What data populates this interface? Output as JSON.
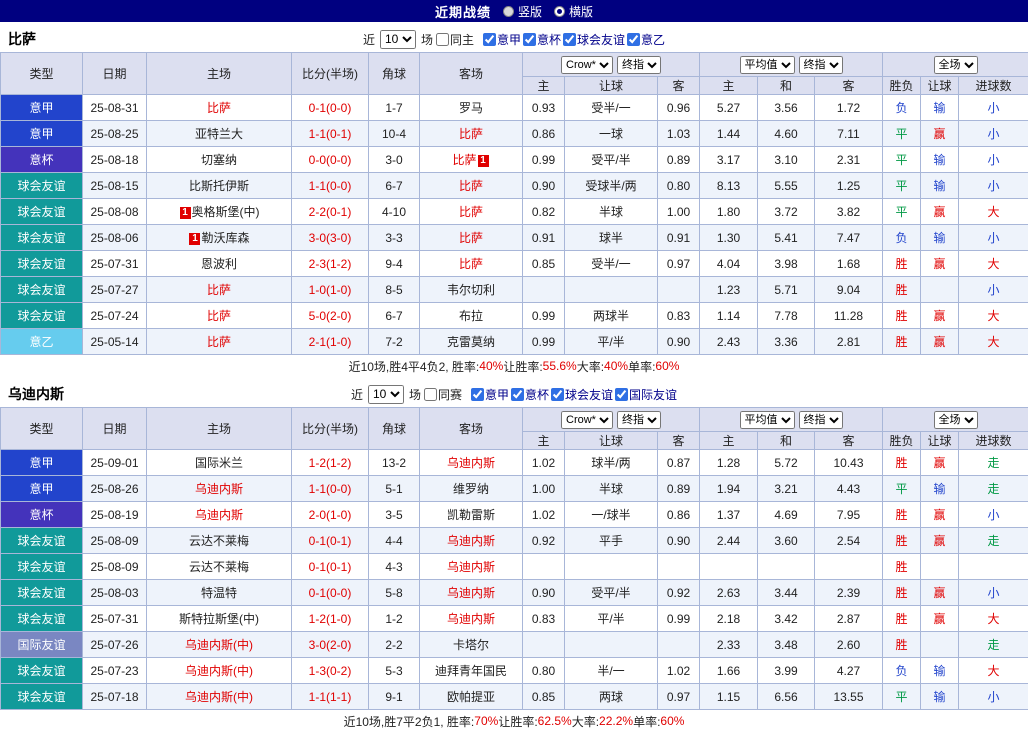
{
  "top_bar": {
    "title": "近期战绩",
    "radios": [
      {
        "label": "竖版",
        "selected": false
      },
      {
        "label": "横版",
        "selected": true
      }
    ]
  },
  "table_header": {
    "type": "类型",
    "date": "日期",
    "home": "主场",
    "score": "比分(半场)",
    "corner": "角球",
    "away": "客场",
    "odds_selects": [
      "Crow*",
      "终指"
    ],
    "avg_selects": [
      "平均值",
      "终指"
    ],
    "full_selects": [
      "全场"
    ],
    "sub_headers": [
      "主",
      "让球",
      "客",
      "主",
      "和",
      "客",
      "胜负",
      "让球",
      "进球数"
    ]
  },
  "type_colors": {
    "意甲": "#2244cc",
    "意杯": "#4433bb",
    "意乙": "#66ccee",
    "球会友谊": "#119a9a",
    "国际友谊": "#7a87c2"
  },
  "value_colors": {
    "胜": "#e00000",
    "平": "#009944",
    "负": "#2244cc",
    "赢": "#e00000",
    "输": "#2244cc",
    "大": "#e00000",
    "小": "#2244cc",
    "走": "#009944"
  },
  "sections": [
    {
      "team": "比萨",
      "filter": {
        "near_label": "近",
        "count": "10",
        "games_label": "场",
        "same_label": "同主",
        "same_checked": false,
        "leagues": [
          {
            "label": "意甲",
            "checked": true
          },
          {
            "label": "意杯",
            "checked": true
          },
          {
            "label": "球会友谊",
            "checked": true
          },
          {
            "label": "意乙",
            "checked": true
          }
        ]
      },
      "rows": [
        {
          "type": "意甲",
          "date": "25-08-31",
          "home": "比萨",
          "home_red": true,
          "home_badge": "",
          "score": "0-1(0-0)",
          "corner": "1-7",
          "away": "罗马",
          "away_red": false,
          "away_badge": "",
          "odds": [
            "0.93",
            "受半/一",
            "0.96"
          ],
          "avg": [
            "5.27",
            "3.56",
            "1.72"
          ],
          "res": [
            "负",
            "输",
            "小"
          ]
        },
        {
          "type": "意甲",
          "date": "25-08-25",
          "home": "亚特兰大",
          "home_red": false,
          "home_badge": "",
          "score": "1-1(0-1)",
          "corner": "10-4",
          "away": "比萨",
          "away_red": true,
          "away_badge": "",
          "odds": [
            "0.86",
            "一球",
            "1.03"
          ],
          "avg": [
            "1.44",
            "4.60",
            "7.11"
          ],
          "res": [
            "平",
            "赢",
            "小"
          ]
        },
        {
          "type": "意杯",
          "date": "25-08-18",
          "home": "切塞纳",
          "home_red": false,
          "home_badge": "",
          "score": "0-0(0-0)",
          "corner": "3-0",
          "away": "比萨",
          "away_red": true,
          "away_badge": "1",
          "odds": [
            "0.99",
            "受平/半",
            "0.89"
          ],
          "avg": [
            "3.17",
            "3.10",
            "2.31"
          ],
          "res": [
            "平",
            "输",
            "小"
          ]
        },
        {
          "type": "球会友谊",
          "date": "25-08-15",
          "home": "比斯托伊斯",
          "home_red": false,
          "home_badge": "",
          "score": "1-1(0-0)",
          "corner": "6-7",
          "away": "比萨",
          "away_red": true,
          "away_badge": "",
          "odds": [
            "0.90",
            "受球半/两",
            "0.80"
          ],
          "avg": [
            "8.13",
            "5.55",
            "1.25"
          ],
          "res": [
            "平",
            "输",
            "小"
          ]
        },
        {
          "type": "球会友谊",
          "date": "25-08-08",
          "home": "奥格斯堡(中)",
          "home_red": false,
          "home_badge": "1",
          "score": "2-2(0-1)",
          "corner": "4-10",
          "away": "比萨",
          "away_red": true,
          "away_badge": "",
          "odds": [
            "0.82",
            "半球",
            "1.00"
          ],
          "avg": [
            "1.80",
            "3.72",
            "3.82"
          ],
          "res": [
            "平",
            "赢",
            "大"
          ]
        },
        {
          "type": "球会友谊",
          "date": "25-08-06",
          "home": "勒沃库森",
          "home_red": false,
          "home_badge": "1",
          "score": "3-0(3-0)",
          "corner": "3-3",
          "away": "比萨",
          "away_red": true,
          "away_badge": "",
          "odds": [
            "0.91",
            "球半",
            "0.91"
          ],
          "avg": [
            "1.30",
            "5.41",
            "7.47"
          ],
          "res": [
            "负",
            "输",
            "小"
          ]
        },
        {
          "type": "球会友谊",
          "date": "25-07-31",
          "home": "恩波利",
          "home_red": false,
          "home_badge": "",
          "score": "2-3(1-2)",
          "corner": "9-4",
          "away": "比萨",
          "away_red": true,
          "away_badge": "",
          "odds": [
            "0.85",
            "受半/一",
            "0.97"
          ],
          "avg": [
            "4.04",
            "3.98",
            "1.68"
          ],
          "res": [
            "胜",
            "赢",
            "大"
          ]
        },
        {
          "type": "球会友谊",
          "date": "25-07-27",
          "home": "比萨",
          "home_red": true,
          "home_badge": "",
          "score": "1-0(1-0)",
          "corner": "8-5",
          "away": "韦尔切利",
          "away_red": false,
          "away_badge": "",
          "odds": [
            "",
            "",
            ""
          ],
          "avg": [
            "1.23",
            "5.71",
            "9.04"
          ],
          "res": [
            "胜",
            "",
            "小"
          ]
        },
        {
          "type": "球会友谊",
          "date": "25-07-24",
          "home": "比萨",
          "home_red": true,
          "home_badge": "",
          "score": "5-0(2-0)",
          "corner": "6-7",
          "away": "布拉",
          "away_red": false,
          "away_badge": "",
          "odds": [
            "0.99",
            "两球半",
            "0.83"
          ],
          "avg": [
            "1.14",
            "7.78",
            "11.28"
          ],
          "res": [
            "胜",
            "赢",
            "大"
          ]
        },
        {
          "type": "意乙",
          "date": "25-05-14",
          "home": "比萨",
          "home_red": true,
          "home_badge": "",
          "score": "2-1(1-0)",
          "corner": "7-2",
          "away": "克雷莫纳",
          "away_red": false,
          "away_badge": "",
          "odds": [
            "0.99",
            "平/半",
            "0.90"
          ],
          "avg": [
            "2.43",
            "3.36",
            "2.81"
          ],
          "res": [
            "胜",
            "赢",
            "大"
          ]
        }
      ],
      "summary_parts": [
        {
          "text": "近10场,胜4平4负2, 胜率:",
          "red": false
        },
        {
          "text": "40%",
          "red": true
        },
        {
          "text": " 让胜率:",
          "red": false
        },
        {
          "text": "55.6%",
          "red": true
        },
        {
          "text": " 大率:",
          "red": false
        },
        {
          "text": "40%",
          "red": true
        },
        {
          "text": " 单率:",
          "red": false
        },
        {
          "text": "60%",
          "red": true
        }
      ]
    },
    {
      "team": "乌迪内斯",
      "filter": {
        "near_label": "近",
        "count": "10",
        "games_label": "场",
        "same_label": "同赛",
        "same_checked": false,
        "leagues": [
          {
            "label": "意甲",
            "checked": true
          },
          {
            "label": "意杯",
            "checked": true
          },
          {
            "label": "球会友谊",
            "checked": true
          },
          {
            "label": "国际友谊",
            "checked": true
          }
        ]
      },
      "rows": [
        {
          "type": "意甲",
          "date": "25-09-01",
          "home": "国际米兰",
          "home_red": false,
          "home_badge": "",
          "score": "1-2(1-2)",
          "corner": "13-2",
          "away": "乌迪内斯",
          "away_red": true,
          "away_badge": "",
          "odds": [
            "1.02",
            "球半/两",
            "0.87"
          ],
          "avg": [
            "1.28",
            "5.72",
            "10.43"
          ],
          "res": [
            "胜",
            "赢",
            "走"
          ]
        },
        {
          "type": "意甲",
          "date": "25-08-26",
          "home": "乌迪内斯",
          "home_red": true,
          "home_badge": "",
          "score": "1-1(0-0)",
          "corner": "5-1",
          "away": "维罗纳",
          "away_red": false,
          "away_badge": "",
          "odds": [
            "1.00",
            "半球",
            "0.89"
          ],
          "avg": [
            "1.94",
            "3.21",
            "4.43"
          ],
          "res": [
            "平",
            "输",
            "走"
          ]
        },
        {
          "type": "意杯",
          "date": "25-08-19",
          "home": "乌迪内斯",
          "home_red": true,
          "home_badge": "",
          "score": "2-0(1-0)",
          "corner": "3-5",
          "away": "凯勒雷斯",
          "away_red": false,
          "away_badge": "",
          "odds": [
            "1.02",
            "一/球半",
            "0.86"
          ],
          "avg": [
            "1.37",
            "4.69",
            "7.95"
          ],
          "res": [
            "胜",
            "赢",
            "小"
          ]
        },
        {
          "type": "球会友谊",
          "date": "25-08-09",
          "home": "云达不莱梅",
          "home_red": false,
          "home_badge": "",
          "score": "0-1(0-1)",
          "corner": "4-4",
          "away": "乌迪内斯",
          "away_red": true,
          "away_badge": "",
          "odds": [
            "0.92",
            "平手",
            "0.90"
          ],
          "avg": [
            "2.44",
            "3.60",
            "2.54"
          ],
          "res": [
            "胜",
            "赢",
            "走"
          ]
        },
        {
          "type": "球会友谊",
          "date": "25-08-09",
          "home": "云达不莱梅",
          "home_red": false,
          "home_badge": "",
          "score": "0-1(0-1)",
          "corner": "4-3",
          "away": "乌迪内斯",
          "away_red": true,
          "away_badge": "",
          "odds": [
            "",
            "",
            ""
          ],
          "avg": [
            "",
            "",
            ""
          ],
          "res": [
            "胜",
            "",
            ""
          ]
        },
        {
          "type": "球会友谊",
          "date": "25-08-03",
          "home": "特温特",
          "home_red": false,
          "home_badge": "",
          "score": "0-1(0-0)",
          "corner": "5-8",
          "away": "乌迪内斯",
          "away_red": true,
          "away_badge": "",
          "odds": [
            "0.90",
            "受平/半",
            "0.92"
          ],
          "avg": [
            "2.63",
            "3.44",
            "2.39"
          ],
          "res": [
            "胜",
            "赢",
            "小"
          ]
        },
        {
          "type": "球会友谊",
          "date": "25-07-31",
          "home": "斯特拉斯堡(中)",
          "home_red": false,
          "home_badge": "",
          "score": "1-2(1-0)",
          "corner": "1-2",
          "away": "乌迪内斯",
          "away_red": true,
          "away_badge": "",
          "odds": [
            "0.83",
            "平/半",
            "0.99"
          ],
          "avg": [
            "2.18",
            "3.42",
            "2.87"
          ],
          "res": [
            "胜",
            "赢",
            "大"
          ]
        },
        {
          "type": "国际友谊",
          "date": "25-07-26",
          "home": "乌迪内斯(中)",
          "home_red": true,
          "home_badge": "",
          "score": "3-0(2-0)",
          "corner": "2-2",
          "away": "卡塔尔",
          "away_red": false,
          "away_badge": "",
          "odds": [
            "",
            "",
            ""
          ],
          "avg": [
            "2.33",
            "3.48",
            "2.60"
          ],
          "res": [
            "胜",
            "",
            "走"
          ]
        },
        {
          "type": "球会友谊",
          "date": "25-07-23",
          "home": "乌迪内斯(中)",
          "home_red": true,
          "home_badge": "",
          "score": "1-3(0-2)",
          "corner": "5-3",
          "away": "迪拜青年国民",
          "away_red": false,
          "away_badge": "",
          "odds": [
            "0.80",
            "半/一",
            "1.02"
          ],
          "avg": [
            "1.66",
            "3.99",
            "4.27"
          ],
          "res": [
            "负",
            "输",
            "大"
          ]
        },
        {
          "type": "球会友谊",
          "date": "25-07-18",
          "home": "乌迪内斯(中)",
          "home_red": true,
          "home_badge": "",
          "score": "1-1(1-1)",
          "corner": "9-1",
          "away": "欧帕提亚",
          "away_red": false,
          "away_badge": "",
          "odds": [
            "0.85",
            "两球",
            "0.97"
          ],
          "avg": [
            "1.15",
            "6.56",
            "13.55"
          ],
          "res": [
            "平",
            "输",
            "小"
          ]
        }
      ],
      "summary_parts": [
        {
          "text": "近10场,胜7平2负1, 胜率:",
          "red": false
        },
        {
          "text": "70%",
          "red": true
        },
        {
          "text": " 让胜率:",
          "red": false
        },
        {
          "text": "62.5%",
          "red": true
        },
        {
          "text": " 大率:",
          "red": false
        },
        {
          "text": "22.2%",
          "red": true
        },
        {
          "text": " 单率:",
          "red": false
        },
        {
          "text": "60%",
          "red": true
        }
      ]
    }
  ]
}
